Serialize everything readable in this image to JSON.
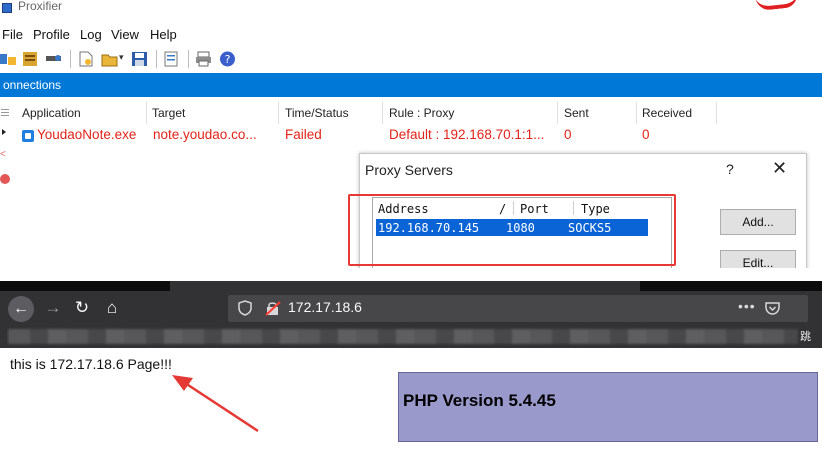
{
  "proxifier": {
    "title": "Proxifier",
    "menu": [
      "File",
      "Profile",
      "Log",
      "View",
      "Help"
    ],
    "connections_label": "onnections",
    "columns": [
      "Application",
      "Target",
      "Time/Status",
      "Rule : Proxy",
      "Sent",
      "Received"
    ],
    "row": {
      "application": "YoudaoNote.exe",
      "target": "note.youdao.co...",
      "status": "Failed",
      "rule": "Default : 192.168.70.1:1...",
      "sent": "0",
      "received": "0"
    },
    "row_color": "#e2231a",
    "accent": "#0078d7"
  },
  "proxy_dialog": {
    "title": "Proxy Servers",
    "help": "?",
    "close": "✕",
    "columns": [
      "Address",
      "/",
      "Port",
      "Type"
    ],
    "server": {
      "address": "192.168.70.145",
      "port": "1080",
      "type": "SOCKS5"
    },
    "buttons": {
      "add": "Add...",
      "edit": "Edit..."
    },
    "highlight_color": "#e53935"
  },
  "browser": {
    "url": "172.17.18.6",
    "more": "•••",
    "bookmarks_end": "跳",
    "icons": [
      "back-icon",
      "forward-icon",
      "reload-icon",
      "home-icon",
      "shield-icon",
      "insecure-lock-icon",
      "pocket-icon"
    ]
  },
  "page": {
    "text": "this is 172.17.18.6 Page!!!",
    "php_version": "PHP Version 5.4.45",
    "php_banner_color": "#9999cc",
    "arrow_color": "#e53935"
  }
}
